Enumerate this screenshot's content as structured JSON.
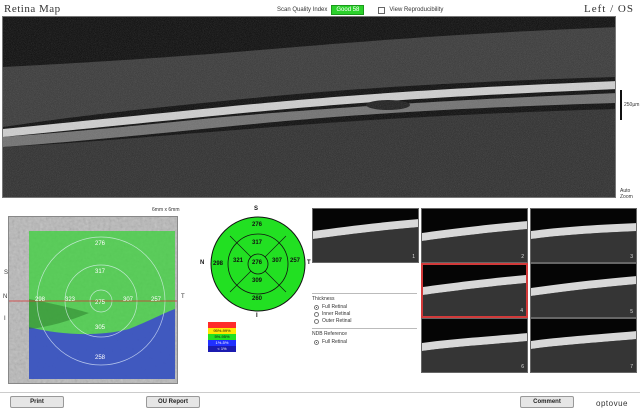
{
  "header": {
    "title": "Retina Map",
    "eye": "Left / OS",
    "quality_label": "Scan Quality Index",
    "quality_value": "Good 58",
    "reproducibility_label": "View Reproducibility"
  },
  "bscan": {
    "scale_label": "250µm",
    "autozoom_line1": "Auto",
    "autozoom_line2": "Zoom"
  },
  "enface": {
    "size_label": "6mm x 6mm",
    "direction_s": "S",
    "direction_i": "I",
    "direction_n": "N",
    "direction_t": "T",
    "values": {
      "outer_top": "276",
      "inner_top": "317",
      "outer_left": "298",
      "inner_left": "323",
      "center": "275",
      "inner_right": "307",
      "outer_right": "257",
      "inner_bottom": "305",
      "outer_bottom": "258"
    }
  },
  "etdrs": {
    "direction_s": "S",
    "direction_i": "I",
    "direction_n": "N",
    "direction_t": "T",
    "values": {
      "outer_top": "276",
      "inner_top": "317",
      "outer_left": "298",
      "inner_left": "321",
      "center": "276",
      "inner_right": "307",
      "outer_right": "257",
      "inner_bottom": "309",
      "outer_bottom": "260"
    },
    "color": "#22e022"
  },
  "legend": [
    {
      "label": "",
      "color": "#ff2a2a"
    },
    {
      "label": "95%-99%",
      "color": "#ffe600"
    },
    {
      "label": "5%-95%",
      "color": "#22e022"
    },
    {
      "label": "1%-5%",
      "color": "#2030ff"
    },
    {
      "label": "< 1%",
      "color": "#1b1bb0"
    }
  ],
  "thickness_panel": {
    "title": "Thickness",
    "options": [
      "Full Retinal",
      "Inner Retinal",
      "Outer Retinal"
    ],
    "selected": 0,
    "reference_title": "NDB Reference",
    "reference_options": [
      "Full Retinal"
    ],
    "reference_selected": 0
  },
  "thumbnails": [
    "1",
    "2",
    "3",
    "4",
    "5",
    "6",
    "7"
  ],
  "selected_thumbnail": "4",
  "buttons": {
    "print": "Print",
    "ou_report": "OU Report",
    "comment": "Comment"
  },
  "logo": "optovue"
}
